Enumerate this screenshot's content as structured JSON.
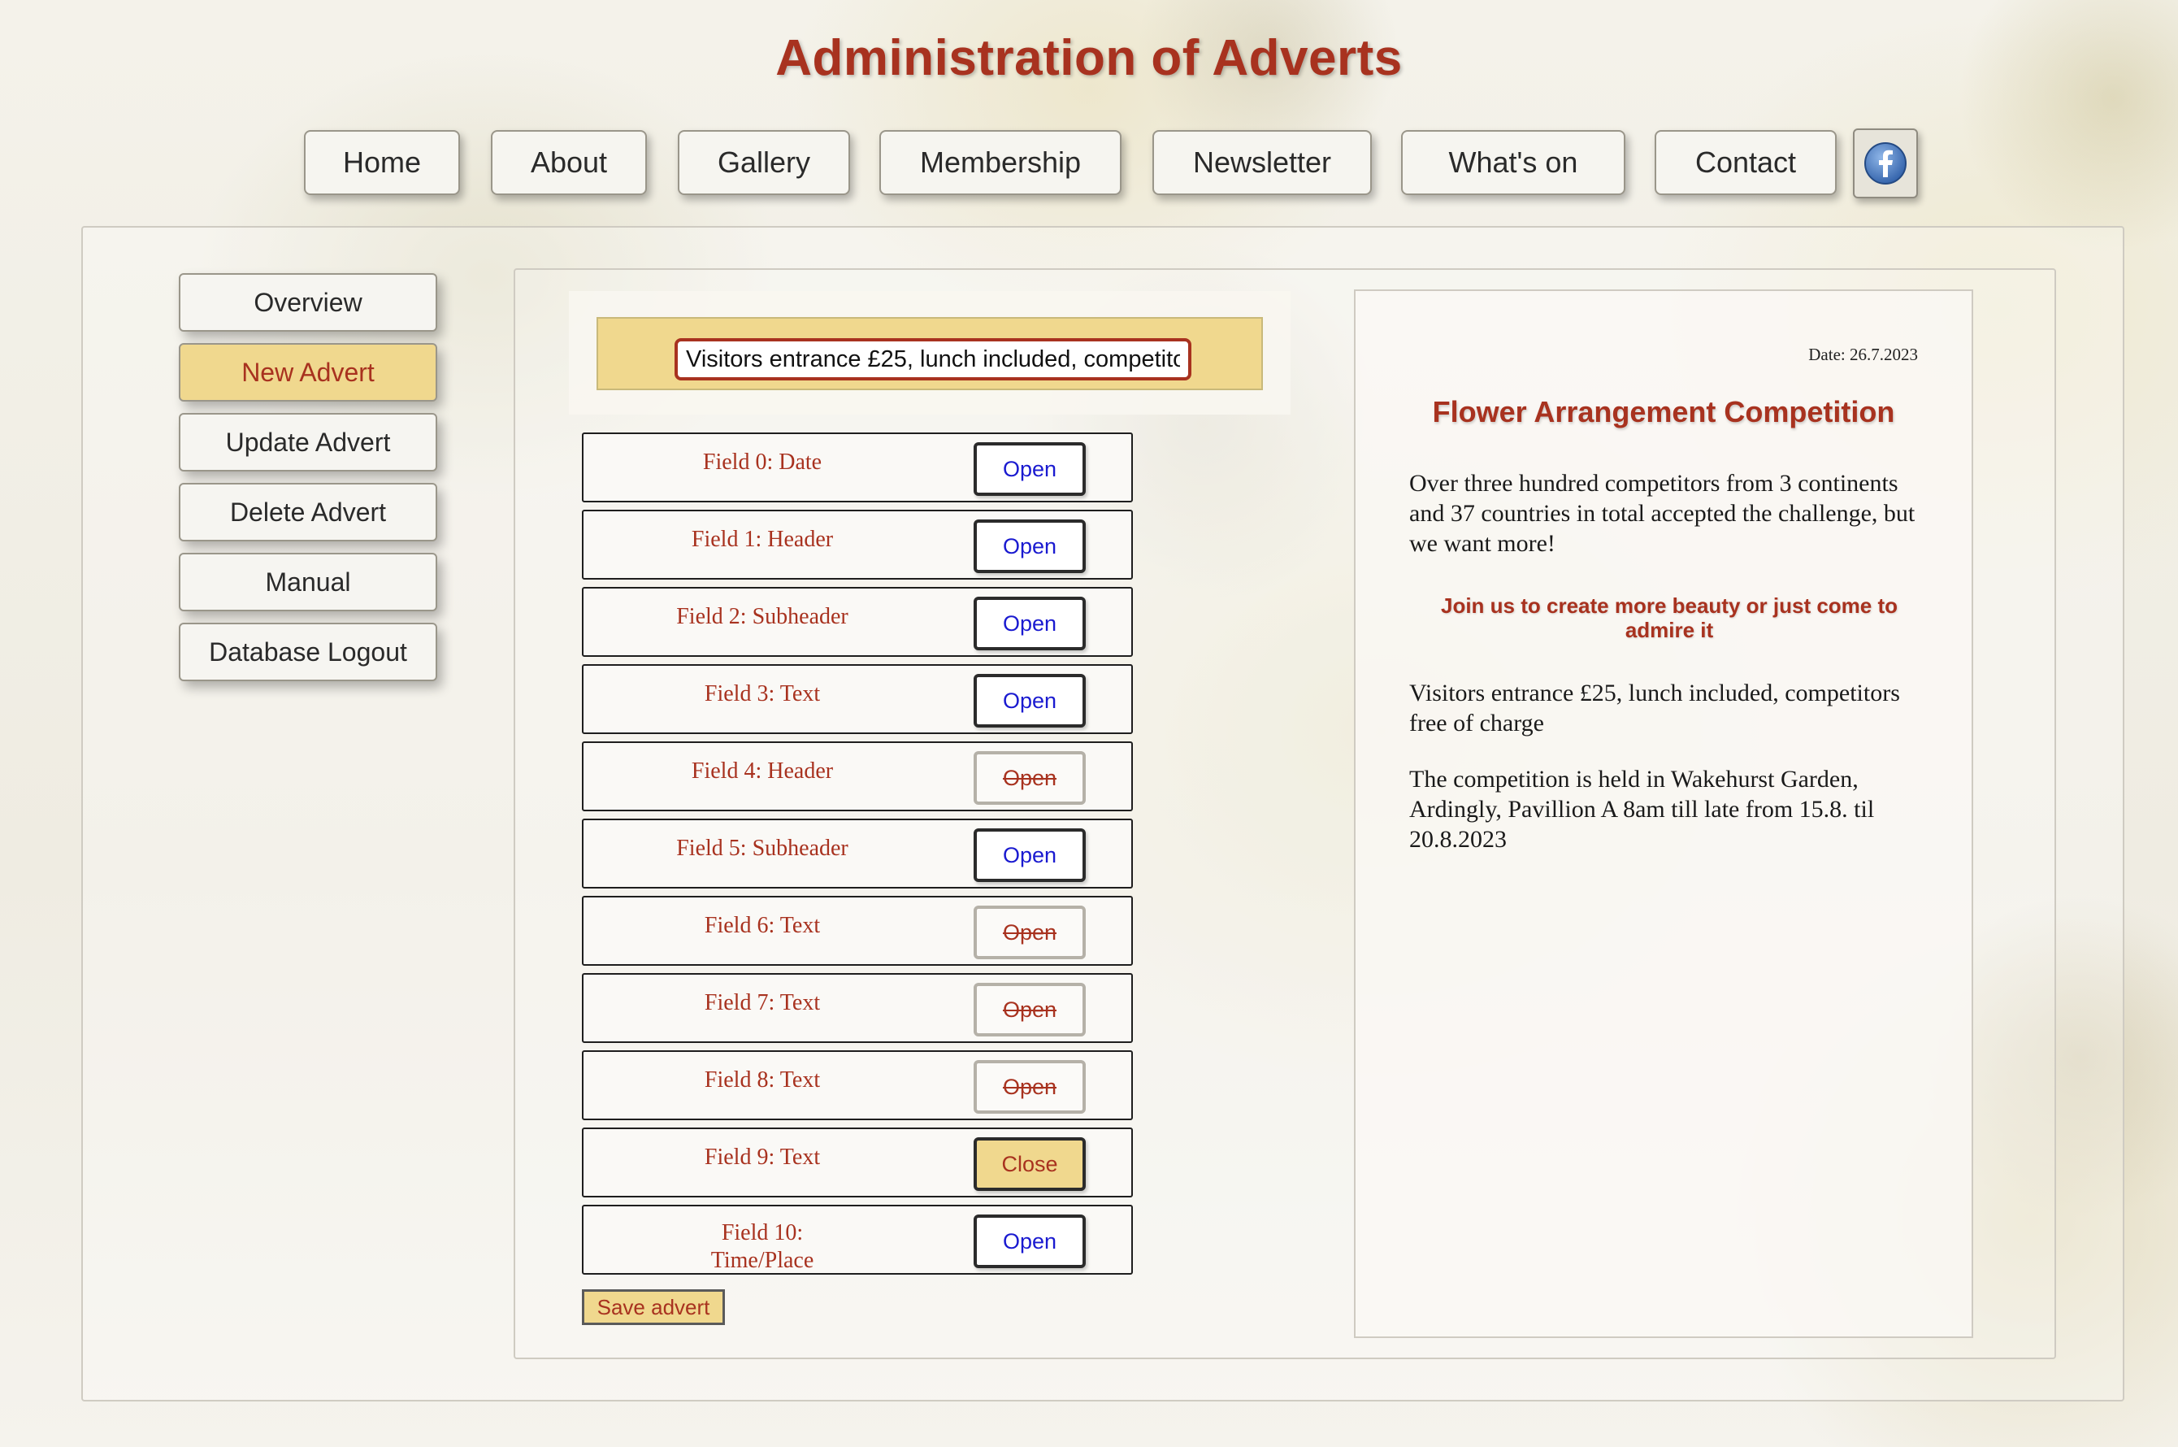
{
  "page": {
    "title": "Administration of Adverts"
  },
  "nav": {
    "items": [
      {
        "label": "Home"
      },
      {
        "label": "About"
      },
      {
        "label": "Gallery"
      },
      {
        "label": "Membership"
      },
      {
        "label": "Newsletter"
      },
      {
        "label": "What's on"
      },
      {
        "label": "Contact"
      }
    ],
    "social_icon": "facebook-icon"
  },
  "sidebar": {
    "items": [
      {
        "label": "Overview",
        "active": false
      },
      {
        "label": "New Advert",
        "active": true
      },
      {
        "label": "Update Advert",
        "active": false
      },
      {
        "label": "Delete Advert",
        "active": false
      },
      {
        "label": "Manual",
        "active": false
      },
      {
        "label": "Database Logout",
        "active": false
      }
    ]
  },
  "editor": {
    "input_value": "Visitors entrance £25, lunch included, competitors free of charge",
    "fields": [
      {
        "label": "Field 0: Date",
        "button": "Open",
        "state": "enabled"
      },
      {
        "label": "Field 1: Header",
        "button": "Open",
        "state": "enabled"
      },
      {
        "label": "Field 2: Subheader",
        "button": "Open",
        "state": "enabled"
      },
      {
        "label": "Field 3: Text",
        "button": "Open",
        "state": "enabled"
      },
      {
        "label": "Field 4: Header",
        "button": "Open",
        "state": "disabled"
      },
      {
        "label": "Field 5: Subheader",
        "button": "Open",
        "state": "enabled"
      },
      {
        "label": "Field 6: Text",
        "button": "Open",
        "state": "disabled"
      },
      {
        "label": "Field 7: Text",
        "button": "Open",
        "state": "disabled"
      },
      {
        "label": "Field 8: Text",
        "button": "Open",
        "state": "disabled"
      },
      {
        "label": "Field 9: Text",
        "button": "Close",
        "state": "active"
      },
      {
        "label": "Field 10: Time/Place",
        "button": "Open",
        "state": "enabled"
      }
    ],
    "save_label": "Save advert"
  },
  "preview": {
    "date": "Date: 26.7.2023",
    "header": "Flower Arrangement Competition",
    "text1": "Over three hundred competitors from 3 continents and 37 countries in total accepted the challenge, but we want more!",
    "subheader": "Join us to create more beauty or just come to admire it",
    "text2": "Visitors entrance £25, lunch included, competitors free of charge",
    "text3": "The competition is held in Wakehurst Garden, Ardingly, Pavillion A 8am till late from 15.8. til 20.8.2023"
  },
  "colors": {
    "accent": "#a8321f",
    "highlight": "#f0d88e",
    "link_blue": "#1a1ad0"
  }
}
